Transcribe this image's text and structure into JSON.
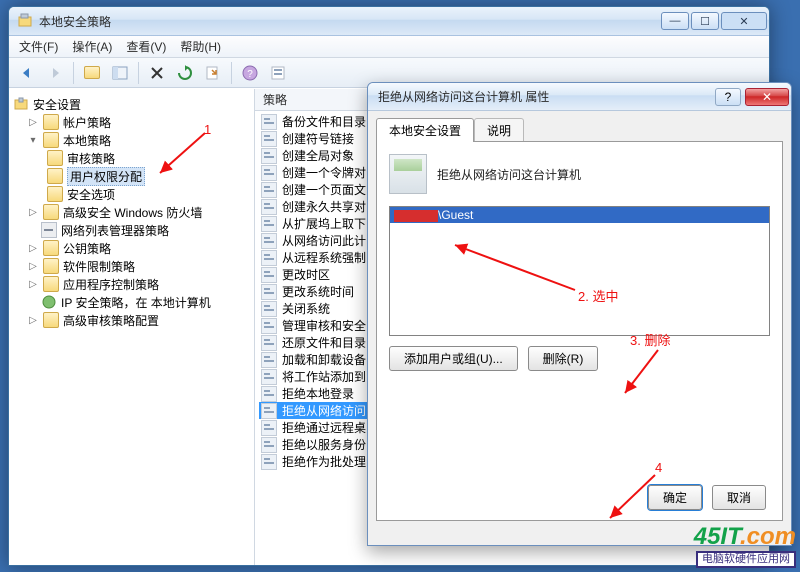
{
  "main_window": {
    "title": "本地安全策略",
    "menu": {
      "file": "文件(F)",
      "action": "操作(A)",
      "view": "查看(V)",
      "help": "帮助(H)"
    }
  },
  "tree": {
    "root": "安全设置",
    "items": [
      {
        "label": "帐户策略"
      },
      {
        "label": "本地策略",
        "children": [
          {
            "label": "审核策略"
          },
          {
            "label": "用户权限分配",
            "selected": true
          },
          {
            "label": "安全选项"
          }
        ]
      },
      {
        "label": "高级安全 Windows 防火墙"
      },
      {
        "label": "网络列表管理器策略"
      },
      {
        "label": "公钥策略"
      },
      {
        "label": "软件限制策略"
      },
      {
        "label": "应用程序控制策略"
      },
      {
        "label": "IP 安全策略，在 本地计算机"
      },
      {
        "label": "高级审核策略配置"
      }
    ]
  },
  "list": {
    "header": "策略",
    "items": [
      "备份文件和目录",
      "创建符号链接",
      "创建全局对象",
      "创建一个令牌对",
      "创建一个页面文",
      "创建永久共享对",
      "从扩展坞上取下",
      "从网络访问此计",
      "从远程系统强制",
      "更改时区",
      "更改系统时间",
      "关闭系统",
      "管理审核和安全",
      "还原文件和目录",
      "加载和卸载设备",
      "将工作站添加到",
      "拒绝本地登录",
      "拒绝从网络访问",
      "拒绝通过远程桌",
      "拒绝以服务身份",
      "拒绝作为批处理"
    ],
    "selected_index": 17
  },
  "dialog": {
    "title": "拒绝从网络访问这台计算机 属性",
    "tab_local": "本地安全设置",
    "tab_explain": "说明",
    "heading": "拒绝从网络访问这台计算机",
    "list_item": "\\Guest",
    "btn_add": "添加用户或组(U)...",
    "btn_remove": "删除(R)",
    "btn_ok": "确定",
    "btn_cancel": "取消"
  },
  "annotations": {
    "a1": "1",
    "a2": "2. 选中",
    "a3": "3. 删除",
    "a4": "4"
  },
  "watermark": {
    "brand": "45IT",
    "suffix": ".com",
    "sub": "电脑软硬件应用网"
  }
}
